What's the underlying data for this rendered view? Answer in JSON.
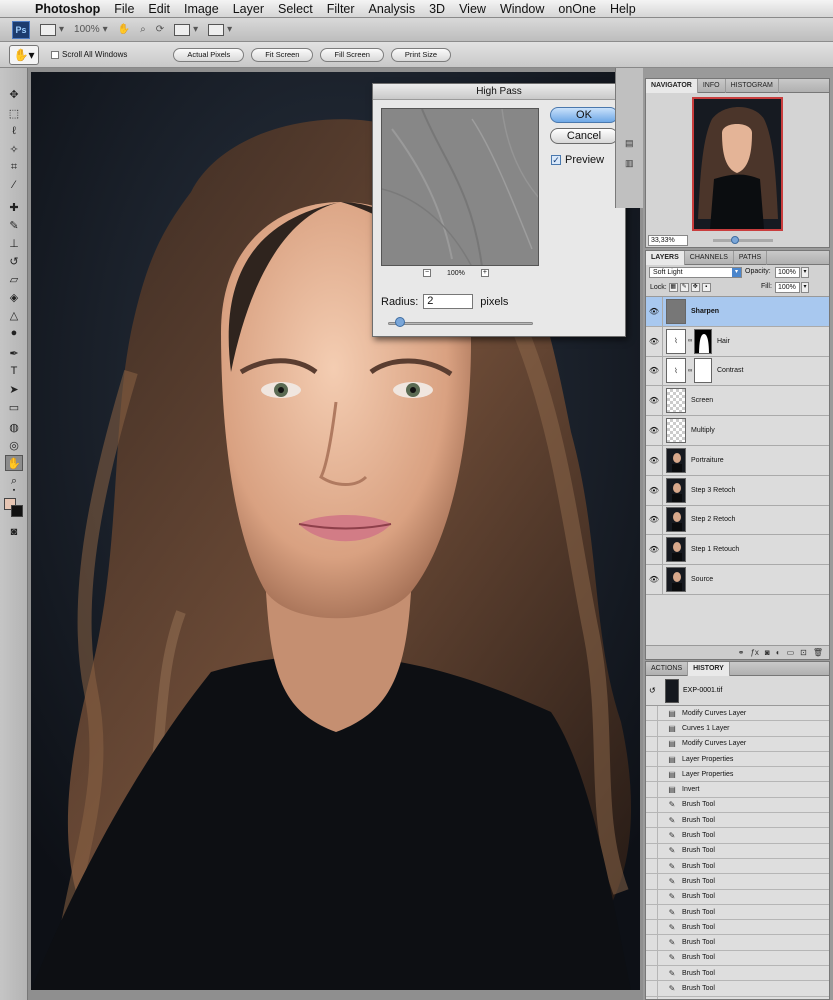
{
  "menu": {
    "app_name": "Photoshop",
    "items": [
      "File",
      "Edit",
      "Image",
      "Layer",
      "Select",
      "Filter",
      "Analysis",
      "3D",
      "View",
      "Window",
      "onOne",
      "Help"
    ]
  },
  "appbar": {
    "logo": "Ps",
    "zoom": "100%"
  },
  "options": {
    "scroll_all_label": "Scroll All Windows",
    "buttons": [
      "Actual Pixels",
      "Fit Screen",
      "Fill Screen",
      "Print Size"
    ]
  },
  "high_pass": {
    "title": "High Pass",
    "ok_label": "OK",
    "cancel_label": "Cancel",
    "preview_label": "Preview",
    "preview_checked": true,
    "zoom_label": "100%",
    "zoom_minus": "−",
    "zoom_plus": "+",
    "radius_label": "Radius:",
    "radius_value": "2",
    "radius_unit": "pixels"
  },
  "panels": {
    "top_tabs": [
      "NAVIGATOR",
      "INFO",
      "HISTOGRAM"
    ],
    "nav_zoom": "33,33%",
    "layer_tabs": [
      "LAYERS",
      "CHANNELS",
      "PATHS"
    ],
    "bottom_tabs": [
      "ACTIONS",
      "HISTORY"
    ]
  },
  "layers": {
    "blend_mode": "Soft Light",
    "opacity_label": "Opacity:",
    "opacity": "100%",
    "lock_label": "Lock:",
    "fill_label": "Fill:",
    "fill": "100%",
    "rows": [
      {
        "name": "Sharpen",
        "thumb": "gray",
        "selected": true
      },
      {
        "name": "Hair",
        "thumb": "adj",
        "mask": "hair"
      },
      {
        "name": "Contrast",
        "thumb": "adj",
        "mask": "white"
      },
      {
        "name": "Screen",
        "thumb": "trans"
      },
      {
        "name": "Multiply",
        "thumb": "trans"
      },
      {
        "name": "Portraiture",
        "thumb": "photo"
      },
      {
        "name": "Step 3 Retoch",
        "thumb": "photo"
      },
      {
        "name": "Step 2 Retoch",
        "thumb": "photo"
      },
      {
        "name": "Step 1 Retouch",
        "thumb": "photo"
      },
      {
        "name": "Source",
        "thumb": "photo"
      }
    ]
  },
  "history": {
    "snapshot": "EXP-0001.tif",
    "items": [
      {
        "label": "Modify Curves Layer",
        "icon": "doc-icon"
      },
      {
        "label": "Curves 1 Layer",
        "icon": "doc-icon"
      },
      {
        "label": "Modify Curves Layer",
        "icon": "doc-icon"
      },
      {
        "label": "Layer Properties",
        "icon": "doc-icon"
      },
      {
        "label": "Layer Properties",
        "icon": "doc-icon"
      },
      {
        "label": "Invert",
        "icon": "doc-icon"
      },
      {
        "label": "Brush Tool",
        "icon": "brush-icon"
      },
      {
        "label": "Brush Tool",
        "icon": "brush-icon"
      },
      {
        "label": "Brush Tool",
        "icon": "brush-icon"
      },
      {
        "label": "Brush Tool",
        "icon": "brush-icon"
      },
      {
        "label": "Brush Tool",
        "icon": "brush-icon"
      },
      {
        "label": "Brush Tool",
        "icon": "brush-icon"
      },
      {
        "label": "Brush Tool",
        "icon": "brush-icon"
      },
      {
        "label": "Brush Tool",
        "icon": "brush-icon"
      },
      {
        "label": "Brush Tool",
        "icon": "brush-icon"
      },
      {
        "label": "Brush Tool",
        "icon": "brush-icon"
      },
      {
        "label": "Brush Tool",
        "icon": "brush-icon"
      },
      {
        "label": "Brush Tool",
        "icon": "brush-icon"
      },
      {
        "label": "Brush Tool",
        "icon": "brush-icon"
      },
      {
        "label": "Brush Tool",
        "icon": "brush-icon"
      }
    ]
  },
  "colors": {
    "selection": "#a8c8ef",
    "foreground": "#e7c6b4",
    "background": "#111111"
  }
}
